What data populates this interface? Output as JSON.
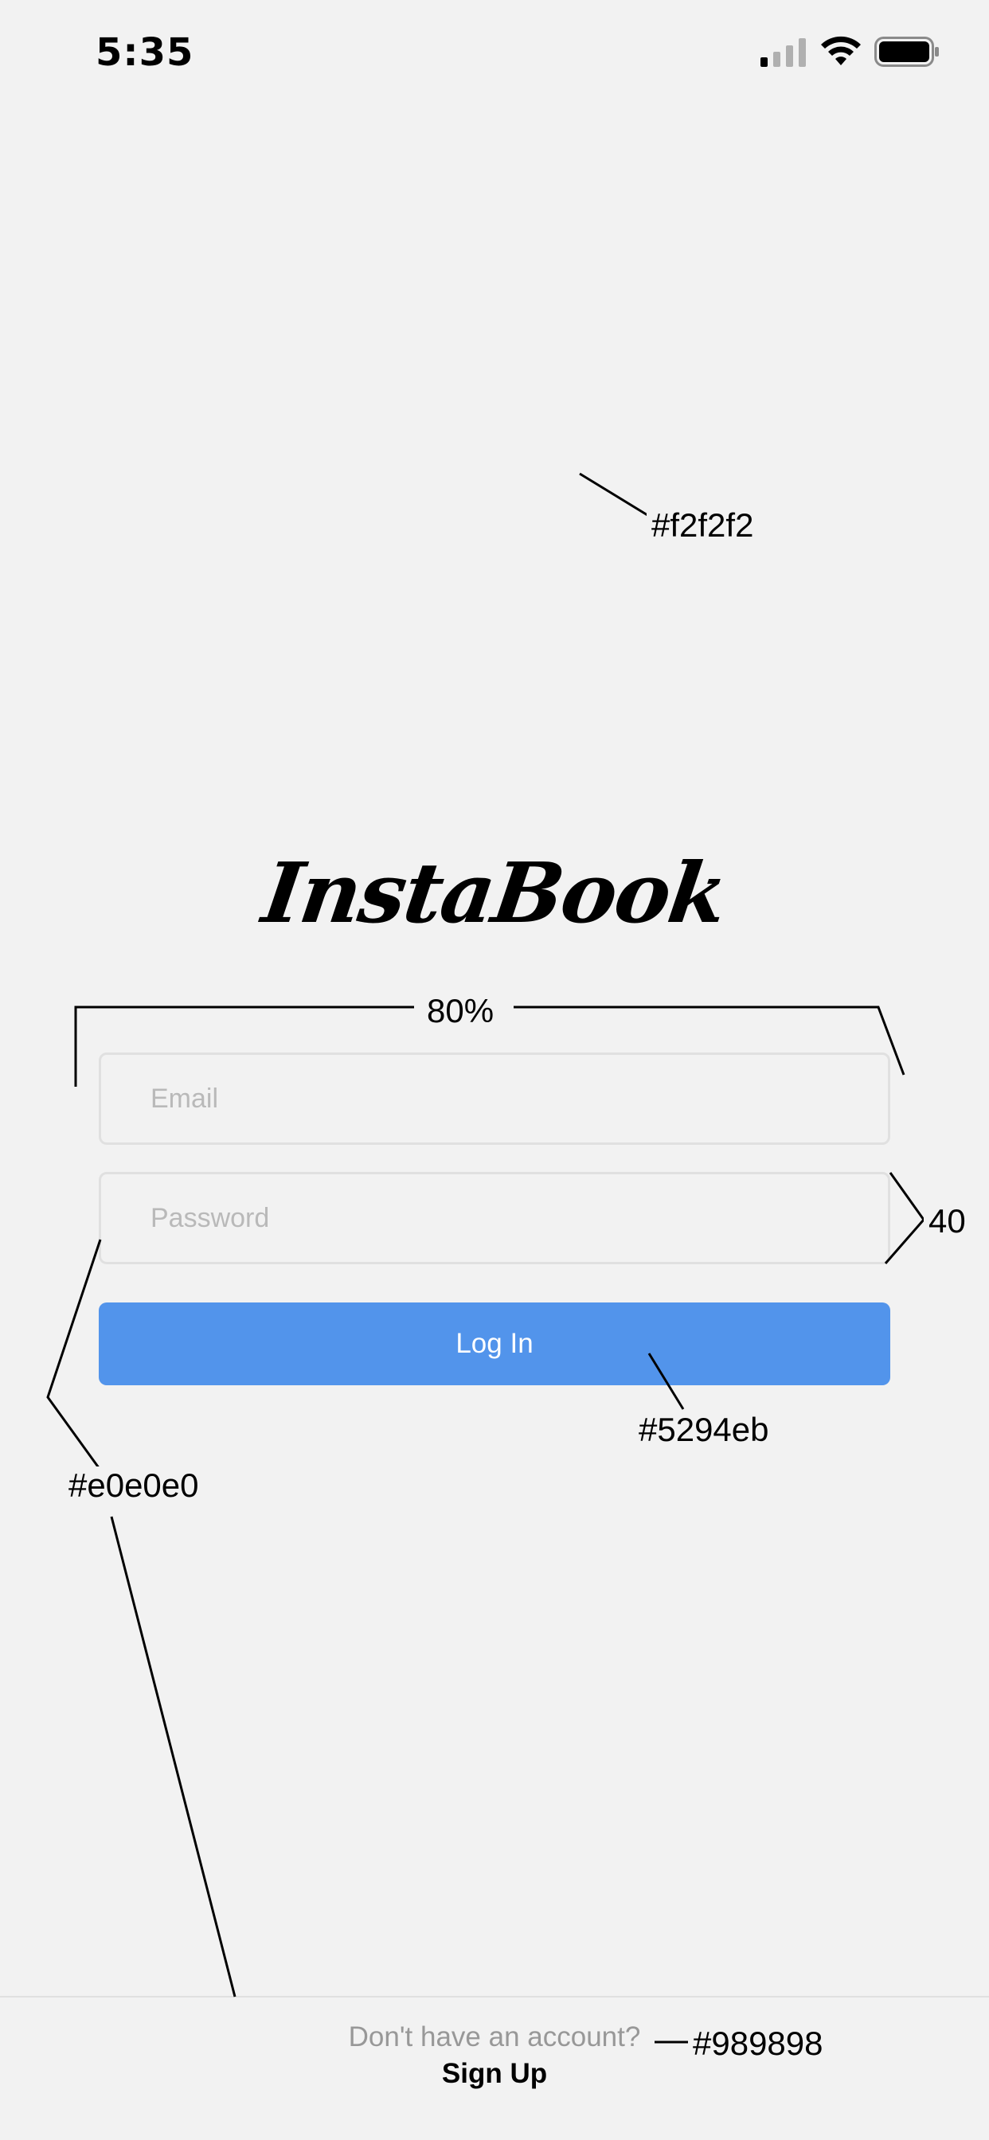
{
  "status_bar": {
    "time": "5:35"
  },
  "logo": {
    "text": "InstaBook"
  },
  "form": {
    "email_placeholder": "Email",
    "password_placeholder": "Password",
    "login_label": "Log In"
  },
  "footer": {
    "prompt": "Don't have an account?",
    "signup_label": "Sign Up"
  },
  "annotations": {
    "background_color": "#f2f2f2",
    "width_note": "80%",
    "height_note": "40",
    "button_color": "#5294eb",
    "border_color": "#e0e0e0",
    "footer_text_color": "#989898"
  },
  "colors": {
    "background": "#f2f2f2",
    "input_border": "#e0e0e0",
    "accent": "#5294eb",
    "muted_text": "#989898"
  }
}
